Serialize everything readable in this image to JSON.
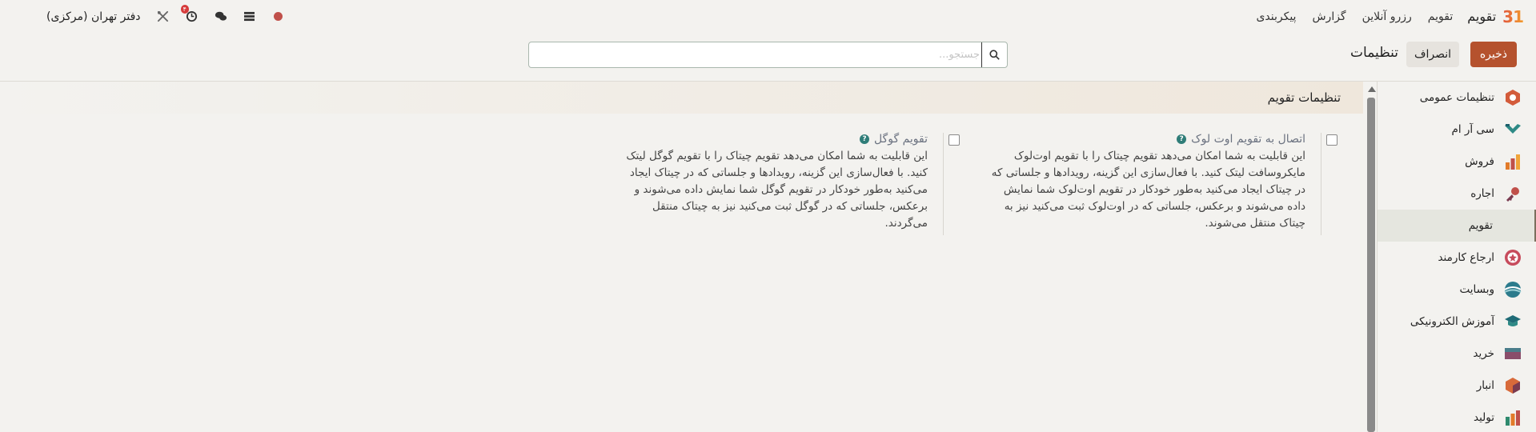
{
  "navbar": {
    "app_icon": "31",
    "app_name": "تقویم",
    "menu": [
      "تقویم",
      "رزرو آنلاین",
      "گزارش",
      "پیکربندی"
    ],
    "activity_badge": "۴",
    "company": "دفتر تهران (مرکزی)",
    "icons": [
      "status-dot-icon",
      "list-icon",
      "chat-icon",
      "activity-clock-icon",
      "tools-icon"
    ]
  },
  "control": {
    "save_label": "ذخیره",
    "cancel_label": "انصراف",
    "title": "تنظیمات",
    "search_placeholder": "جستجو..."
  },
  "sidebar": {
    "items": [
      {
        "label": "تنظیمات عمومی",
        "icon": "general-settings-icon",
        "color": "#d35b3a"
      },
      {
        "label": "سی آر ام",
        "icon": "crm-icon",
        "color": "#2e8a86"
      },
      {
        "label": "فروش",
        "icon": "sales-icon",
        "color": "#e27b2a"
      },
      {
        "label": "اجاره",
        "icon": "rental-icon",
        "color": "#c0504a"
      },
      {
        "label": "تقویم",
        "icon": "calendar-icon",
        "color": "#e0553b",
        "active": true
      },
      {
        "label": "ارجاع کارمند",
        "icon": "referral-icon",
        "color": "#c74b5c"
      },
      {
        "label": "وبسایت",
        "icon": "website-icon",
        "color": "#2c7b8c"
      },
      {
        "label": "آموزش الکترونیکی",
        "icon": "elearning-icon",
        "color": "#1f6b76"
      },
      {
        "label": "خرید",
        "icon": "purchase-icon",
        "color": "#8a4d6a"
      },
      {
        "label": "انبار",
        "icon": "inventory-icon",
        "color": "#d86a3a"
      },
      {
        "label": "تولید",
        "icon": "manufacturing-icon",
        "color": "#2f8a6e"
      }
    ]
  },
  "section": {
    "title": "تنظیمات تقویم"
  },
  "settings": [
    {
      "title": "اتصال به تقویم اوت لوک",
      "desc": "این قابلیت به شما امکان می‌دهد تقویم چیتاک را با تقویم اوت‌لوک مایکروسافت لیتک کنید. با فعال‌سازی این گزینه، رویدادها و جلساتی که در چیتاک ایجاد می‌کنید به‌طور خودکار در تقویم اوت‌لوک شما نمایش داده می‌شوند و برعکس، جلساتی که در اوت‌لوک ثبت می‌کنید نیز به چیتاک منتقل می‌شوند."
    },
    {
      "title": "تقویم گوگل",
      "desc": "این قابلیت به شما امکان می‌دهد تقویم چیتاک را با تقویم گوگل لیتک کنید. با فعال‌سازی این گزینه، رویدادها و جلساتی که در چیتاک ایجاد می‌کنید به‌طور خودکار در تقویم گوگل شما نمایش داده می‌شوند و برعکس، جلساتی که در گوگل ثبت می‌کنید نیز به چیتاک منتقل می‌گردند."
    }
  ]
}
